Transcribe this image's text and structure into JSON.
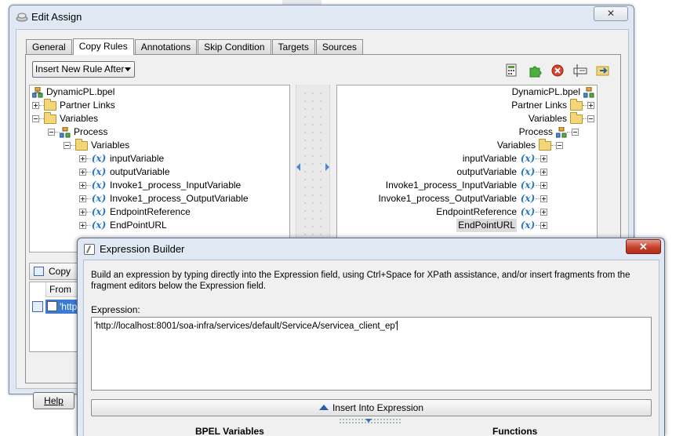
{
  "edit_assign": {
    "title": "Edit Assign",
    "tabs": [
      "General",
      "Copy Rules",
      "Annotations",
      "Skip Condition",
      "Targets",
      "Sources"
    ],
    "active_tab": "Copy Rules",
    "insert_select": "Insert New Rule After",
    "source_tree": {
      "root": "DynamicPL.bpel",
      "partner_links": "Partner Links",
      "variables": "Variables",
      "process": "Process",
      "process_variables": "Variables",
      "items": [
        "inputVariable",
        "outputVariable",
        "Invoke1_process_InputVariable",
        "Invoke1_process_OutputVariable",
        "EndpointReference",
        "EndPointURL"
      ]
    },
    "target_tree": {
      "root": "DynamicPL.bpel",
      "partner_links": "Partner Links",
      "variables": "Variables",
      "process": "Process",
      "process_variables": "Variables",
      "items": [
        "inputVariable",
        "outputVariable",
        "Invoke1_process_InputVariable",
        "Invoke1_process_OutputVariable",
        "EndpointReference",
        "EndPointURL"
      ]
    },
    "copy_tab": "Copy",
    "copy_table": {
      "header": "From",
      "row": "'http"
    },
    "help_button": "Help"
  },
  "expression_builder": {
    "title": "Expression Builder",
    "description": "Build an expression by typing directly into the Expression field, using Ctrl+Space for XPath assistance, and/or insert fragments from the fragment editors below the Expression field.",
    "expression_label": "Expression:",
    "expression_value": "'http://localhost:8001/soa-infra/services/default/ServiceA/servicea_client_ep'",
    "insert_button": "Insert Into Expression",
    "left_pane_title": "BPEL Variables",
    "right_pane_title": "Functions"
  },
  "colors": {
    "variable_icon": "#2a78c5",
    "mapping_line": "#2f6db5",
    "close_red": "#c3412d",
    "selection_blue": "#3b7bd4"
  },
  "icons": [
    "edit-assign-icon",
    "close-icon",
    "calculator-icon",
    "puzzle-icon",
    "delete-icon",
    "id-icon",
    "transfer-icon",
    "folder-icon",
    "process-icon",
    "variable-icon",
    "undo-icon",
    "redo-icon",
    "new-file-icon"
  ]
}
